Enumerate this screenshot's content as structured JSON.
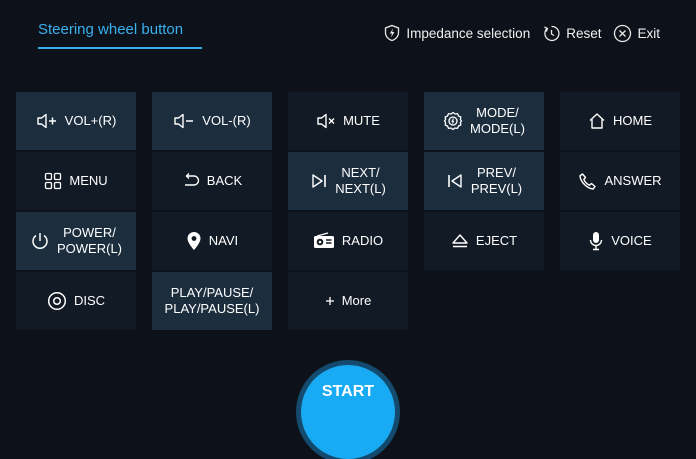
{
  "header": {
    "tab_label": "Steering wheel button",
    "impedance_label": "Impedance selection",
    "reset_label": "Reset",
    "exit_label": "Exit"
  },
  "buttons": [
    {
      "label": "VOL+(R)",
      "icon": "volume-up-icon",
      "highlighted": true
    },
    {
      "label": "VOL-(R)",
      "icon": "volume-down-icon",
      "highlighted": true
    },
    {
      "label": "MUTE",
      "icon": "mute-icon",
      "highlighted": false
    },
    {
      "label": "MODE/\nMODE(L)",
      "icon": "mode-icon",
      "highlighted": true
    },
    {
      "label": "HOME",
      "icon": "home-icon",
      "highlighted": false
    },
    {
      "label": "MENU",
      "icon": "menu-grid-icon",
      "highlighted": false
    },
    {
      "label": "BACK",
      "icon": "back-arrow-icon",
      "highlighted": false
    },
    {
      "label": "NEXT/\nNEXT(L)",
      "icon": "skip-next-icon",
      "highlighted": true
    },
    {
      "label": "PREV/\nPREV(L)",
      "icon": "skip-prev-icon",
      "highlighted": true
    },
    {
      "label": "ANSWER",
      "icon": "phone-icon",
      "highlighted": false
    },
    {
      "label": "POWER/\nPOWER(L)",
      "icon": "power-icon",
      "highlighted": true
    },
    {
      "label": "NAVI",
      "icon": "location-pin-icon",
      "highlighted": false
    },
    {
      "label": "RADIO",
      "icon": "radio-icon",
      "highlighted": false
    },
    {
      "label": "EJECT",
      "icon": "eject-icon",
      "highlighted": false
    },
    {
      "label": "VOICE",
      "icon": "microphone-icon",
      "highlighted": false
    },
    {
      "label": "DISC",
      "icon": "disc-icon",
      "highlighted": false
    },
    {
      "label": "PLAY/PAUSE/\nPLAY/PAUSE(L)",
      "icon": "",
      "highlighted": true
    },
    {
      "label": "More",
      "icon": "plus-icon",
      "highlighted": false
    }
  ],
  "start_label": "START",
  "colors": {
    "background": "#0d1119",
    "accent": "#3ab0ee",
    "button": "#121a25",
    "button_highlight": "#1c2d3d",
    "start": "#19aaf4"
  }
}
